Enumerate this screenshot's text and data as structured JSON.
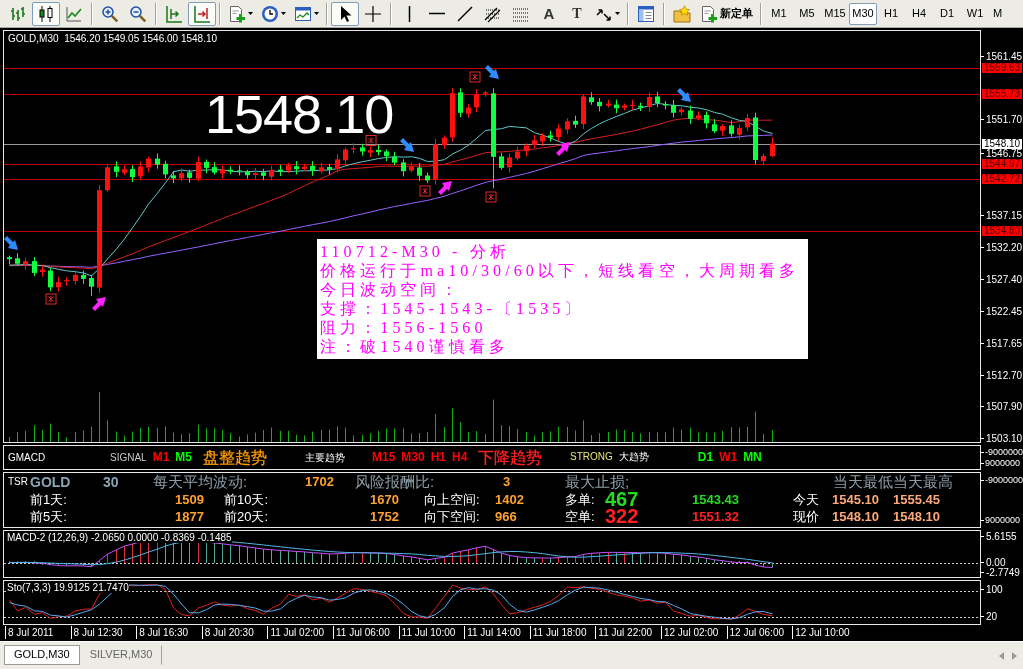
{
  "toolbar": {
    "groups": [
      [
        {
          "pressed": false
        },
        {
          "pressed": true
        },
        {
          "pressed": false
        }
      ],
      [
        {
          "pressed": false
        },
        {
          "pressed": false
        }
      ],
      [
        {
          "pressed": false
        },
        {
          "pressed": true
        }
      ],
      [
        {
          "pressed": false
        },
        {
          "pressed": false
        },
        {
          "pressed": false
        }
      ],
      [
        {
          "pressed": true
        },
        {
          "pressed": false
        }
      ],
      [
        {
          "pressed": false
        },
        {
          "pressed": false
        },
        {
          "pressed": false
        },
        {
          "pressed": false
        },
        {
          "pressed": false
        },
        {
          "pressed": false,
          "glyph": "A"
        },
        {
          "pressed": false,
          "glyph": "T"
        },
        {
          "pressed": false
        }
      ],
      [
        {
          "pressed": false
        }
      ],
      [
        {
          "pressed": false
        },
        {
          "pressed": false,
          "label": "新定单"
        }
      ]
    ],
    "timeframes": [
      {
        "label": "M1",
        "selected": false
      },
      {
        "label": "M5",
        "selected": false
      },
      {
        "label": "M15",
        "selected": false
      },
      {
        "label": "M30",
        "selected": true
      },
      {
        "label": "H1",
        "selected": false
      },
      {
        "label": "H4",
        "selected": false
      },
      {
        "label": "D1",
        "selected": false
      },
      {
        "label": "W1",
        "selected": false
      },
      {
        "label": "M",
        "selected": false
      }
    ]
  },
  "main_chart": {
    "header": "GOLD,M30  1546.20 1549.05 1546.00 1548.10",
    "big_price": "1548.10",
    "analysis": [
      "110712-M30 - 分析",
      "价格运行于ma10/30/60以下，短线看空，大周期看多",
      "今日波动空间：",
      "支撑：1545-1543-〔1535〕",
      "阻力：1556-1560",
      "注：破1540谨慎看多"
    ],
    "price_axis": [
      "1561.45",
      "1551.70",
      "1546.75",
      "1537.15",
      "1532.20",
      "1527.40",
      "1522.45",
      "1517.65",
      "1512.70",
      "1507.90",
      "1503.10"
    ],
    "price_tags": [
      {
        "text": "1559.63",
        "kind": "level"
      },
      {
        "text": "1555.73",
        "kind": "level"
      },
      {
        "text": "1548.10",
        "kind": "bid"
      },
      {
        "text": "1544.97",
        "kind": "level"
      },
      {
        "text": "1542.72",
        "kind": "level"
      },
      {
        "text": "1534.80",
        "kind": "level"
      }
    ]
  },
  "signal_panel": {
    "title": "GMACD",
    "groups": [
      {
        "labels": [
          {
            "text": "SIGNAL",
            "kind": "name"
          }
        ],
        "frames": [
          {
            "label": "M1",
            "color": "#ff0000"
          },
          {
            "label": "M5",
            "color": "#00ff00"
          }
        ],
        "trend": {
          "text": "盘整趋势",
          "kind": "sideways"
        }
      },
      {
        "labels": [
          {
            "text": "主要趋势",
            "kind": "caption"
          }
        ],
        "frames": [
          {
            "label": "M15",
            "color": "#ff0000"
          },
          {
            "label": "M30",
            "color": "#ff0000"
          },
          {
            "label": "H1",
            "color": "#ff0000"
          },
          {
            "label": "H4",
            "color": "#ff0000"
          }
        ],
        "trend": {
          "text": "下降趋势",
          "kind": "down"
        }
      },
      {
        "labels": [
          {
            "text": "STRONG",
            "kind": "strength"
          },
          {
            "text": "大趋势",
            "kind": "caption"
          }
        ],
        "frames": [
          {
            "label": "D1",
            "color": "#00ff00"
          },
          {
            "label": "W1",
            "color": "#ff0000"
          },
          {
            "label": "MN",
            "color": "#00ff00"
          }
        ]
      }
    ],
    "axis": [
      "-9000000",
      "9000000"
    ]
  },
  "tsr_panel": {
    "summary": [
      {
        "text": "TSR",
        "kind": "title"
      },
      {
        "text": "GOLD",
        "kind": "symbol"
      },
      {
        "text": "30",
        "kind": "symbol"
      },
      {
        "text": "每天平均波动:",
        "kind": "heading"
      },
      {
        "text": "1702",
        "kind": "value",
        "color": "#ffa030"
      },
      {
        "text": "风险报酬比:",
        "kind": "heading"
      },
      {
        "text": "3",
        "kind": "value",
        "color": "#ffa030"
      },
      {
        "text": "最大止损;",
        "kind": "heading"
      },
      {
        "text": "当天最低",
        "kind": "heading"
      },
      {
        "text": "当天最高",
        "kind": "heading"
      }
    ],
    "blocks": [
      {
        "rows": [
          [
            {
              "text": "前1天:",
              "kind": "label"
            },
            {
              "text": "1509",
              "kind": "value",
              "color": "#ffa030"
            }
          ],
          [
            {
              "text": "前5天:",
              "kind": "label"
            },
            {
              "text": "1877",
              "kind": "value",
              "color": "#ffa030"
            }
          ]
        ]
      },
      {
        "rows": [
          [
            {
              "text": "前10天:",
              "kind": "label"
            },
            {
              "text": "1670",
              "kind": "value",
              "color": "#ffa030"
            }
          ],
          [
            {
              "text": "前20天:",
              "kind": "label"
            },
            {
              "text": "1752",
              "kind": "value",
              "color": "#ffa030"
            }
          ]
        ]
      },
      {
        "rows": [
          [
            {
              "text": "向上空间:",
              "kind": "label"
            },
            {
              "text": "1402",
              "kind": "value",
              "color": "#ffa030"
            }
          ],
          [
            {
              "text": "向下空间:",
              "kind": "label"
            },
            {
              "text": "966",
              "kind": "value",
              "color": "#ffa030"
            }
          ]
        ]
      },
      {
        "rows": [
          [
            {
              "text": "多单:",
              "kind": "label"
            },
            {
              "text": "467",
              "kind": "big",
              "color": "#22dd22"
            },
            {
              "text": "1543.43",
              "kind": "value",
              "color": "#22dd22"
            }
          ],
          [
            {
              "text": "空单:",
              "kind": "label"
            },
            {
              "text": "322",
              "kind": "big",
              "color": "#ff2020"
            },
            {
              "text": "1551.32",
              "kind": "value",
              "color": "#ff2020"
            }
          ]
        ]
      },
      {
        "rows": [
          [
            {
              "text": "今天",
              "kind": "label"
            },
            {
              "text": "1545.10",
              "kind": "value",
              "color": "#ffa878"
            },
            {
              "text": "1555.45",
              "kind": "value",
              "color": "#ffa878"
            }
          ],
          [
            {
              "text": "现价",
              "kind": "label"
            },
            {
              "text": "1548.10",
              "kind": "value",
              "color": "#ffa878"
            },
            {
              "text": "1548.10",
              "kind": "value",
              "color": "#ffa878"
            }
          ]
        ]
      }
    ],
    "axis": [
      "-9000000",
      "9000000"
    ]
  },
  "macd_panel": {
    "title": "MACD-2 (12,26,9) -2.0650 0.0000 -0.8369 -0.1485",
    "axis": [
      "5.6155",
      "0.00",
      "-2.7749"
    ]
  },
  "stochastic_panel": {
    "title": "Sto(7,3,3) 19.9125 21.7470",
    "axis": [
      "100",
      "20"
    ]
  },
  "time_axis": [
    "8 Jul 2011",
    "8 Jul 12:30",
    "8 Jul 16:30",
    "8 Jul 20:30",
    "11 Jul 02:00",
    "11 Jul 06:00",
    "11 Jul 10:00",
    "11 Jul 14:00",
    "11 Jul 18:00",
    "11 Jul 22:00",
    "12 Jul 02:00",
    "12 Jul 06:00",
    "12 Jul 10:00"
  ],
  "tabs": [
    {
      "label": "GOLD,M30",
      "selected": true
    },
    {
      "label": "SILVER,M30",
      "selected": false
    }
  ]
}
